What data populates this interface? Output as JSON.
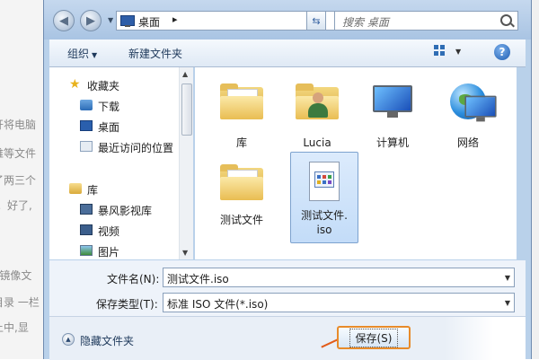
{
  "background": {
    "snippets": [
      {
        "text": "开将电脑"
      },
      {
        "text": "维等文件"
      },
      {
        "text": "了两三个"
      },
      {
        "text": "。好了,"
      },
      {
        "text": "o镜像文"
      },
      {
        "text": "目录 一栏"
      },
      {
        "text": "上中,显"
      }
    ]
  },
  "address": {
    "location": "桌面",
    "separator": "▸"
  },
  "search": {
    "placeholder": "搜索 桌面"
  },
  "toolbar": {
    "organize": "组织",
    "new_folder": "新建文件夹",
    "help": "?"
  },
  "nav": {
    "favorites": "收藏夹",
    "download": "下载",
    "desktop": "桌面",
    "recent": "最近访问的位置",
    "libraries": "库",
    "video_lib": "暴风影视库",
    "videos": "视频",
    "pictures": "图片"
  },
  "files": [
    {
      "label": "库"
    },
    {
      "label": "Lucia"
    },
    {
      "label": "计算机"
    },
    {
      "label": "网络"
    },
    {
      "label": "测试文件"
    },
    {
      "label_line1": "测试文件.",
      "label_line2": "iso"
    }
  ],
  "form": {
    "filename_label": "文件名(N):",
    "filename_value": "测试文件.iso",
    "type_label": "保存类型(T):",
    "type_value": "标准 ISO 文件(*.iso)"
  },
  "footer": {
    "hide_folders": "隐藏文件夹",
    "save": "保存(S)"
  },
  "colors": {
    "accent_border": "#e88b2a",
    "frame": "#b9d1ea",
    "link_text": "#1e395b"
  }
}
